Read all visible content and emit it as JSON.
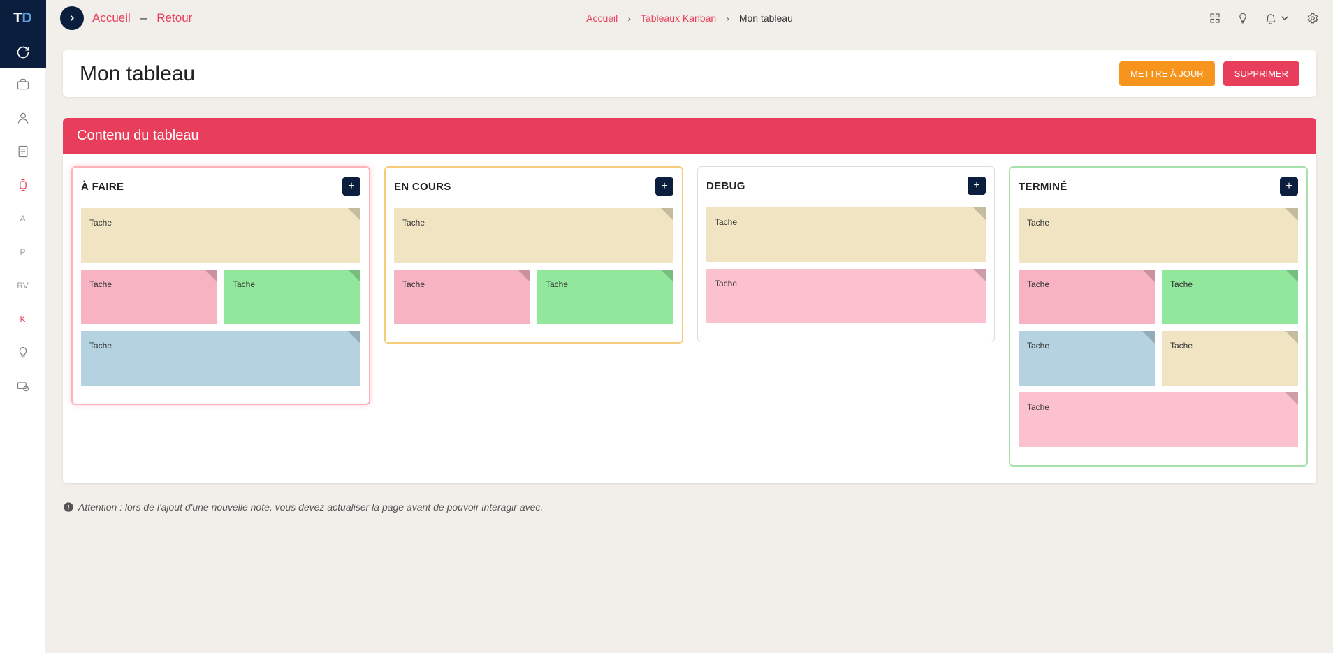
{
  "topbar": {
    "accueil": "Accueil",
    "sep": "–",
    "retour": "Retour"
  },
  "breadcrumb": {
    "home": "Accueil",
    "kanban": "Tableaux Kanban",
    "current": "Mon tableau"
  },
  "sidebar": {
    "txt": {
      "a": "A",
      "p": "P",
      "rv": "RV",
      "k": "K"
    }
  },
  "page": {
    "title": "Mon tableau",
    "update": "METTRE À JOUR",
    "delete": "SUPPRIMER",
    "section": "Contenu du tableau"
  },
  "columns": [
    {
      "title": "À FAIRE",
      "color": "pink",
      "rows": [
        [
          {
            "c": "beige",
            "t": "Tache"
          }
        ],
        [
          {
            "c": "pink",
            "t": "Tache"
          },
          {
            "c": "green",
            "t": "Tache"
          }
        ],
        [
          {
            "c": "blue",
            "t": "Tache"
          }
        ]
      ]
    },
    {
      "title": "EN COURS",
      "color": "yellow",
      "rows": [
        [
          {
            "c": "beige",
            "t": "Tache"
          }
        ],
        [
          {
            "c": "pink",
            "t": "Tache"
          },
          {
            "c": "green",
            "t": "Tache"
          }
        ]
      ]
    },
    {
      "title": "DEBUG",
      "color": "grey",
      "rows": [
        [
          {
            "c": "beige",
            "t": "Tache"
          }
        ],
        [
          {
            "c": "pinklt",
            "t": "Tache"
          }
        ]
      ]
    },
    {
      "title": "TERMINÉ",
      "color": "green",
      "rows": [
        [
          {
            "c": "beige",
            "t": "Tache"
          }
        ],
        [
          {
            "c": "pink",
            "t": "Tache"
          },
          {
            "c": "green",
            "t": "Tache"
          }
        ],
        [
          {
            "c": "blue",
            "t": "Tache"
          },
          {
            "c": "beige",
            "t": "Tache"
          }
        ],
        [
          {
            "c": "pinklt",
            "t": "Tache"
          }
        ]
      ]
    }
  ],
  "hint": "Attention : lors de l'ajout d'une nouvelle note, vous devez actualiser la page avant de pouvoir intéragir avec."
}
